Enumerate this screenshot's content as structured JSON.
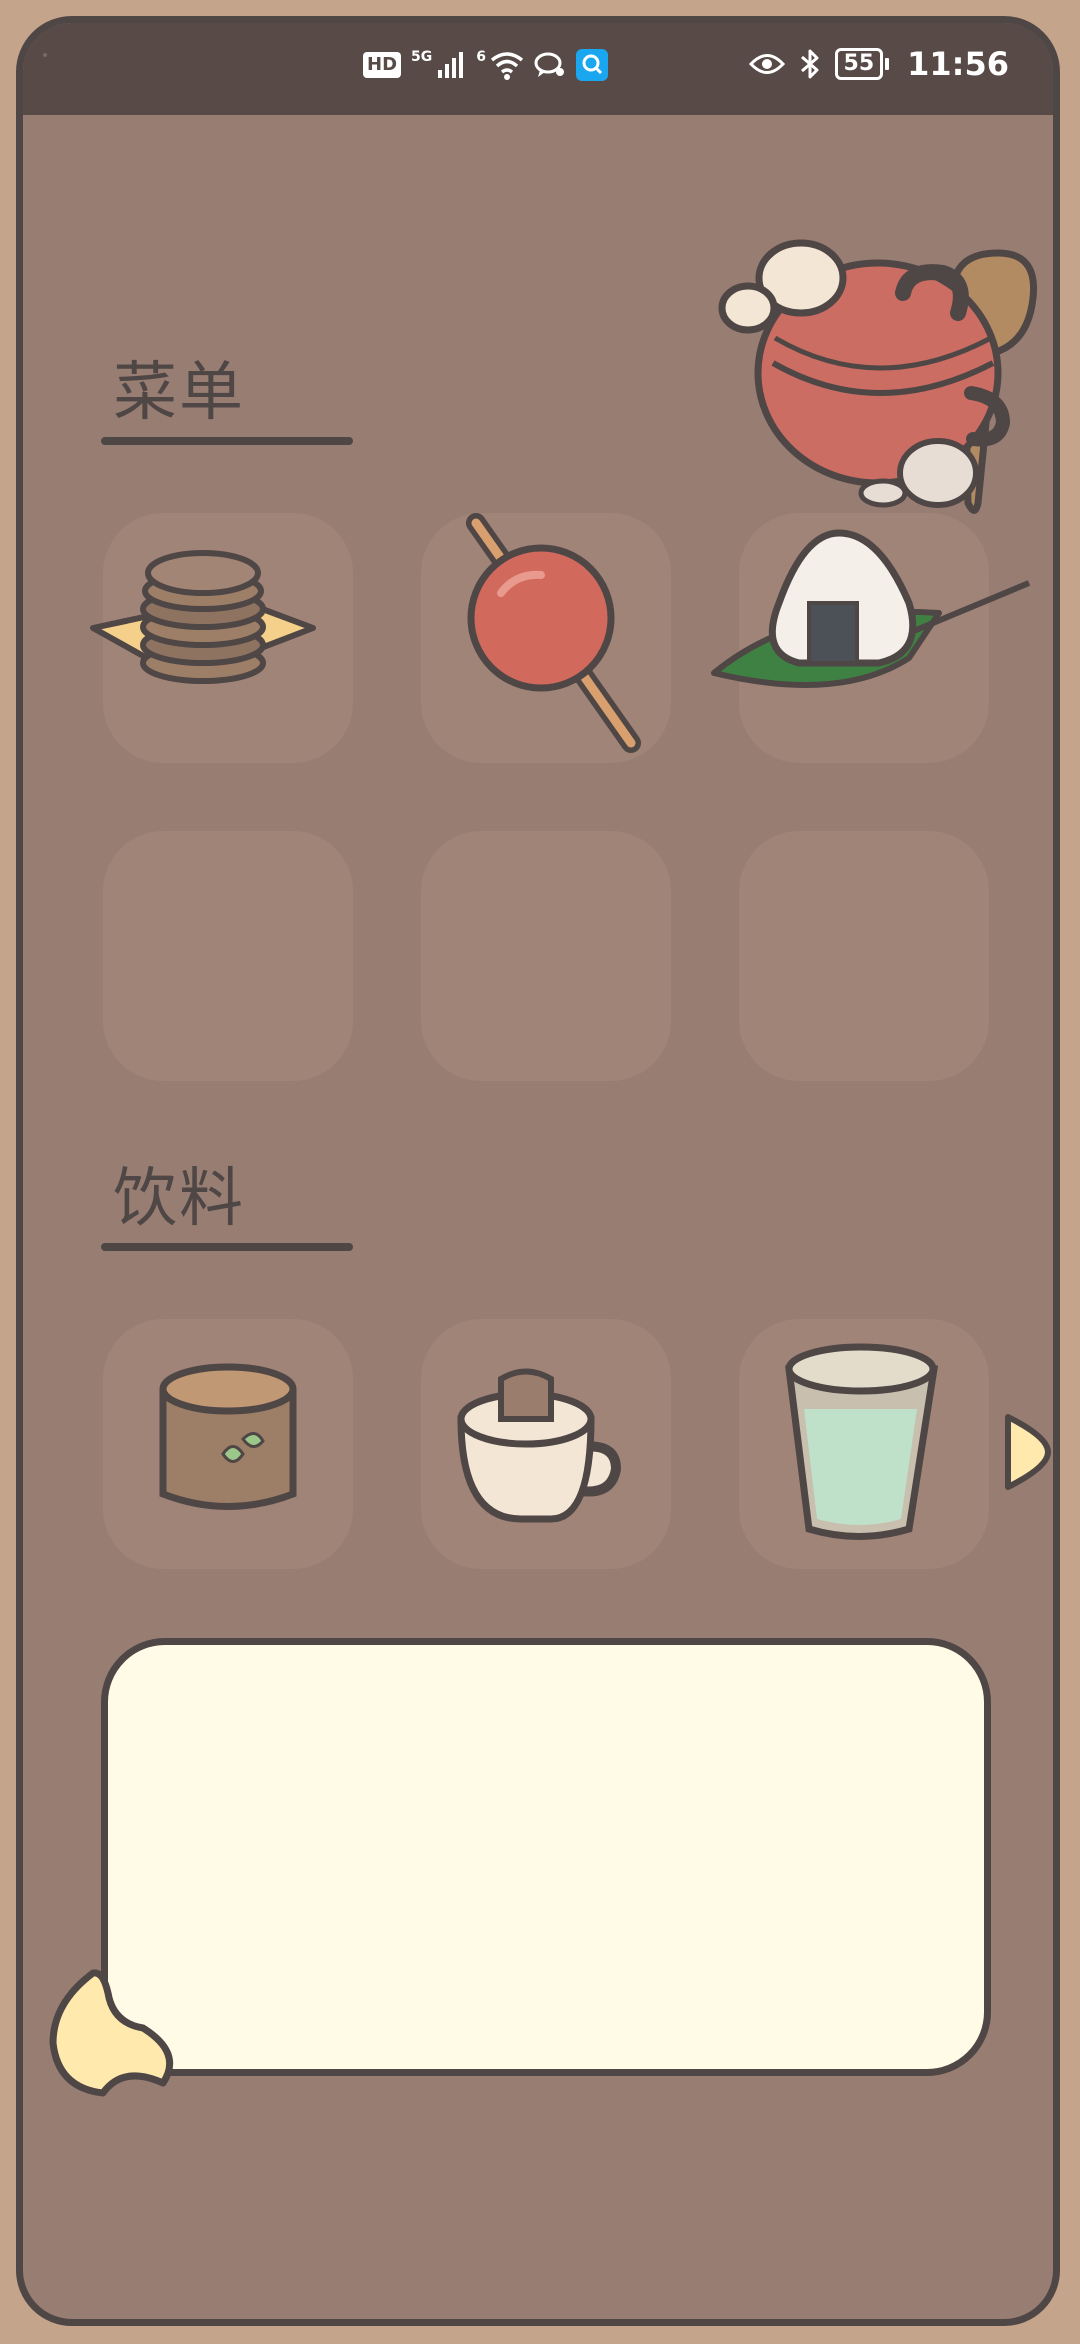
{
  "status_bar": {
    "hd_badge": "HD",
    "signal_label_1": "5G",
    "signal_label_2": "6",
    "battery_level": "55",
    "time": "11:56",
    "icons": [
      "hd-icon",
      "signal-5g-icon",
      "wifi-icon",
      "chat-icon",
      "search-app-icon",
      "eye-icon",
      "bluetooth-icon",
      "battery-icon"
    ]
  },
  "sections": {
    "menu_title": "菜单",
    "drinks_title": "饮料"
  },
  "menu_items": [
    "pancake-stack-icon",
    "candied-apple-icon",
    "onigiri-icon",
    "empty",
    "empty",
    "empty"
  ],
  "drink_items": [
    "tea-cup-icon",
    "coffee-cup-icon",
    "water-glass-icon"
  ],
  "colors": {
    "background": "#987d72",
    "frame_border": "#4f4646",
    "tile": "#a08478",
    "note": "#fffbe6",
    "accent_yellow": "#ffe9ad"
  }
}
